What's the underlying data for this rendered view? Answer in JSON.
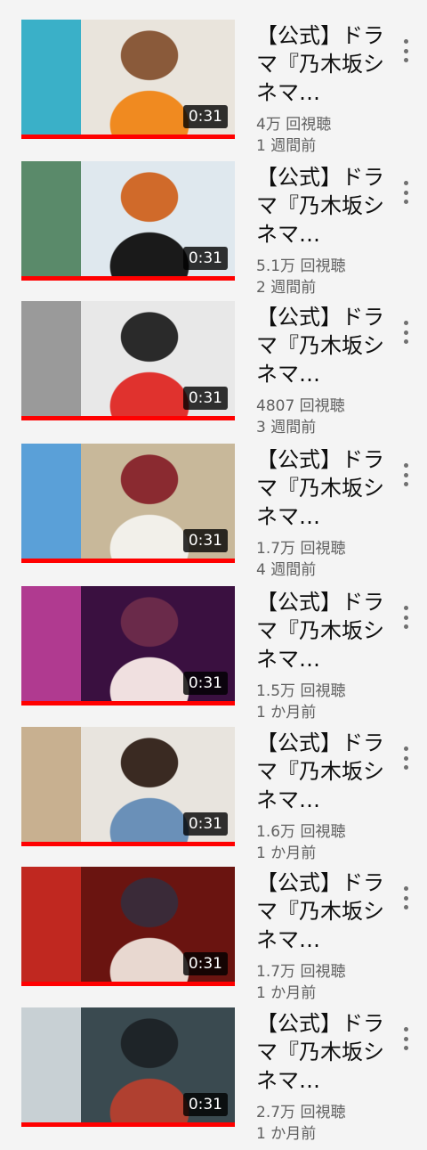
{
  "videos": [
    {
      "title": "【公式】ドラマ『乃木坂シネマ…",
      "duration": "0:31",
      "views": "4万 回視聴",
      "age": "1 週間前",
      "palette": [
        "#e9e4dc",
        "#3ab0c8",
        "#f08a20",
        "#8a5a3a"
      ]
    },
    {
      "title": "【公式】ドラマ『乃木坂シネマ…",
      "duration": "0:31",
      "views": "5.1万 回視聴",
      "age": "2 週間前",
      "palette": [
        "#dfe8ee",
        "#5a8a6a",
        "#1a1a1a",
        "#d06a2a"
      ]
    },
    {
      "title": "【公式】ドラマ『乃木坂シネマ…",
      "duration": "0:31",
      "views": "4807 回視聴",
      "age": "3 週間前",
      "palette": [
        "#e8e8e8",
        "#9a9a9a",
        "#e0322e",
        "#2a2a2a"
      ]
    },
    {
      "title": "【公式】ドラマ『乃木坂シネマ…",
      "duration": "0:31",
      "views": "1.7万 回視聴",
      "age": "4 週間前",
      "palette": [
        "#c8b89a",
        "#5aa0d8",
        "#f2f0ea",
        "#8a2a30"
      ]
    },
    {
      "title": "【公式】ドラマ『乃木坂シネマ…",
      "duration": "0:31",
      "views": "1.5万 回視聴",
      "age": "1 か月前",
      "palette": [
        "#3a1040",
        "#b03a90",
        "#f0e0e0",
        "#6a2a4a"
      ]
    },
    {
      "title": "【公式】ドラマ『乃木坂シネマ…",
      "duration": "0:31",
      "views": "1.6万 回視聴",
      "age": "1 か月前",
      "palette": [
        "#e8e4de",
        "#c8b090",
        "#6a90b8",
        "#3a2a22"
      ]
    },
    {
      "title": "【公式】ドラマ『乃木坂シネマ…",
      "duration": "0:31",
      "views": "1.7万 回視聴",
      "age": "1 か月前",
      "palette": [
        "#6a1410",
        "#c02820",
        "#e8d8d0",
        "#3a2a38"
      ]
    },
    {
      "title": "【公式】ドラマ『乃木坂シネマ…",
      "duration": "0:31",
      "views": "2.7万 回視聴",
      "age": "1 か月前",
      "palette": [
        "#3a4a50",
        "#c8d0d4",
        "#b04030",
        "#1e2428"
      ]
    }
  ]
}
